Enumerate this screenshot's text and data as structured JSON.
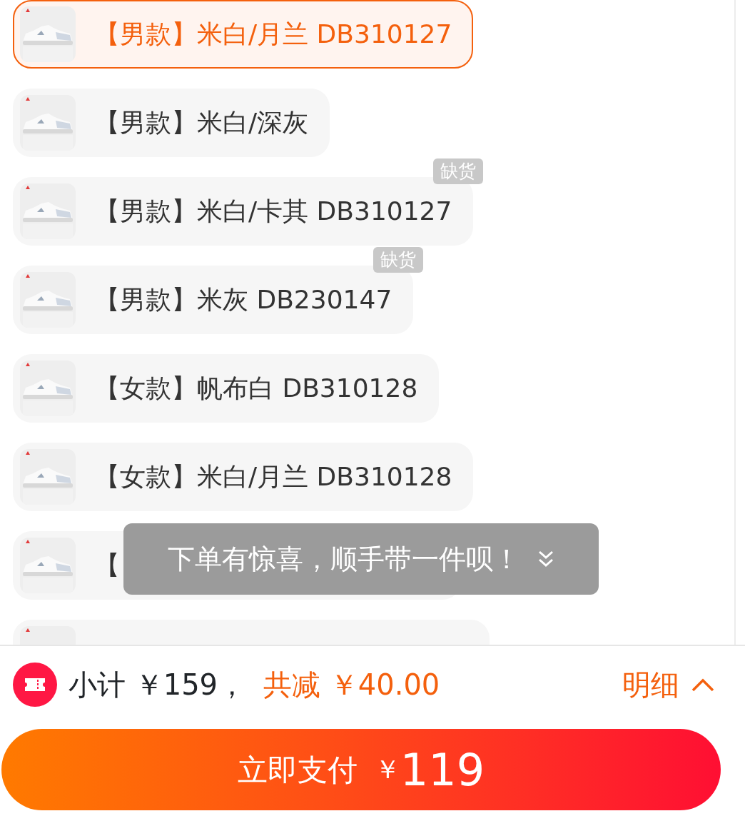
{
  "variants": [
    {
      "label": "【男款】米白/月兰 DB310127",
      "selected": true
    },
    {
      "label": "【男款】米白/深灰",
      "selected": false
    },
    {
      "label": "【男款】米白/卡其 DB310127",
      "selected": false,
      "badge": "缺货"
    },
    {
      "label": "【男款】米灰 DB230147",
      "selected": false,
      "badge": "缺货"
    },
    {
      "label": "【女款】帆布白 DB310128",
      "selected": false
    },
    {
      "label": "【女款】米白/月兰 DB310128",
      "selected": false
    },
    {
      "label": "【",
      "selected": false
    },
    {
      "selected": false
    }
  ],
  "toast": {
    "text": "下单有惊喜，顺手带一件呗！"
  },
  "summary": {
    "subtotal": "小计 ￥159，",
    "discount": "共减 ￥40.00",
    "details": "明细"
  },
  "pay_button": {
    "label": "立即支付",
    "currency": "￥",
    "amount": "119"
  }
}
